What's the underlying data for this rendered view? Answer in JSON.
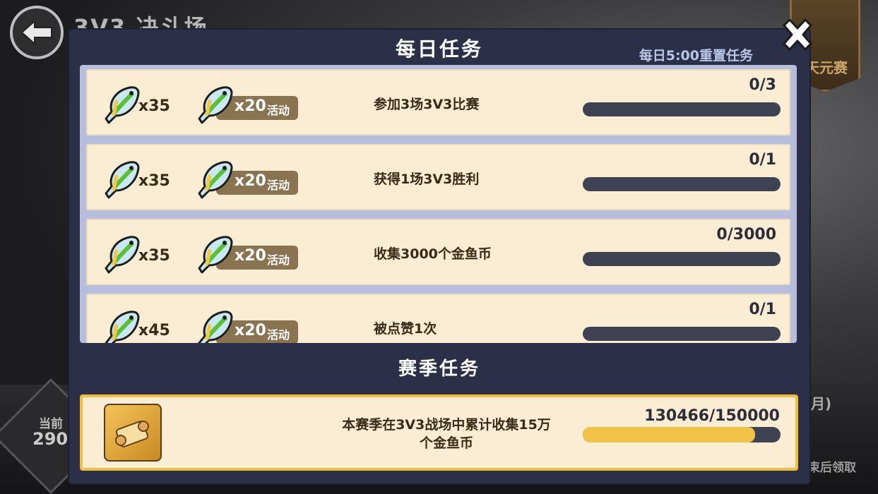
{
  "background": {
    "title": "3V3 决斗场",
    "tianyuan_label": "天元赛",
    "current_label": "当前",
    "current_value": "290",
    "right_text_1": "月)",
    "right_text_2": "束后领取"
  },
  "modal": {
    "title": "每日任务",
    "reset_note": "每日5:00重置任务",
    "season_title": "赛季任务"
  },
  "colors": {
    "modal_bg": "#2b3048",
    "row_bg": "#fbecd4",
    "progress_track": "#3e4253",
    "progress_fill": "#f2c249",
    "season_border": "#f1be3e"
  },
  "daily_tasks": [
    {
      "reward": "x35",
      "event_reward": "x20",
      "event_tag": "活动",
      "desc": "参加3场3V3比赛",
      "progress": "0/3",
      "fraction": 0
    },
    {
      "reward": "x35",
      "event_reward": "x20",
      "event_tag": "活动",
      "desc": "获得1场3V3胜利",
      "progress": "0/1",
      "fraction": 0
    },
    {
      "reward": "x35",
      "event_reward": "x20",
      "event_tag": "活动",
      "desc": "收集3000个金鱼币",
      "progress": "0/3000",
      "fraction": 0
    },
    {
      "reward": "x45",
      "event_reward": "x20",
      "event_tag": "活动",
      "desc": "被点赞1次",
      "progress": "0/1",
      "fraction": 0
    }
  ],
  "season_task": {
    "desc_line1": "本赛季在3V3战场中累计收集15万",
    "desc_line2": "个金鱼币",
    "progress": "130466/150000",
    "fraction": 0.87
  }
}
